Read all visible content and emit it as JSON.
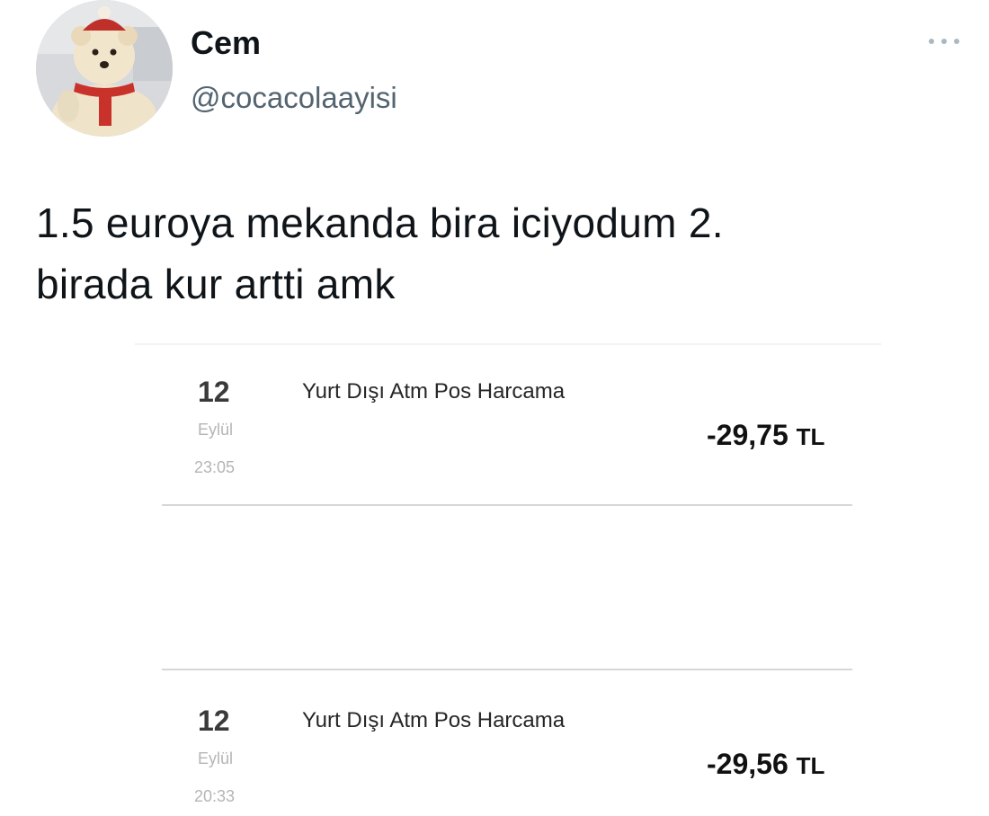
{
  "author": {
    "name": "Cem",
    "handle": "@cocacolaayisi"
  },
  "tweet": {
    "text_line1": "1.5 euroya mekanda bira iciyodum 2.",
    "text_line2": "birada kur artti amk"
  },
  "transactions": [
    {
      "day": "12",
      "month": "Eylül",
      "time": "23:05",
      "description": "Yurt Dışı Atm Pos Harcama",
      "amount": "-29,75",
      "currency": "TL"
    },
    {
      "day": "12",
      "month": "Eylül",
      "time": "20:33",
      "description": "Yurt Dışı Atm Pos Harcama",
      "amount": "-29,56",
      "currency": "TL"
    }
  ],
  "icons": {
    "more": "more-options-icon",
    "avatar": "polar-bear-plush-avatar"
  }
}
